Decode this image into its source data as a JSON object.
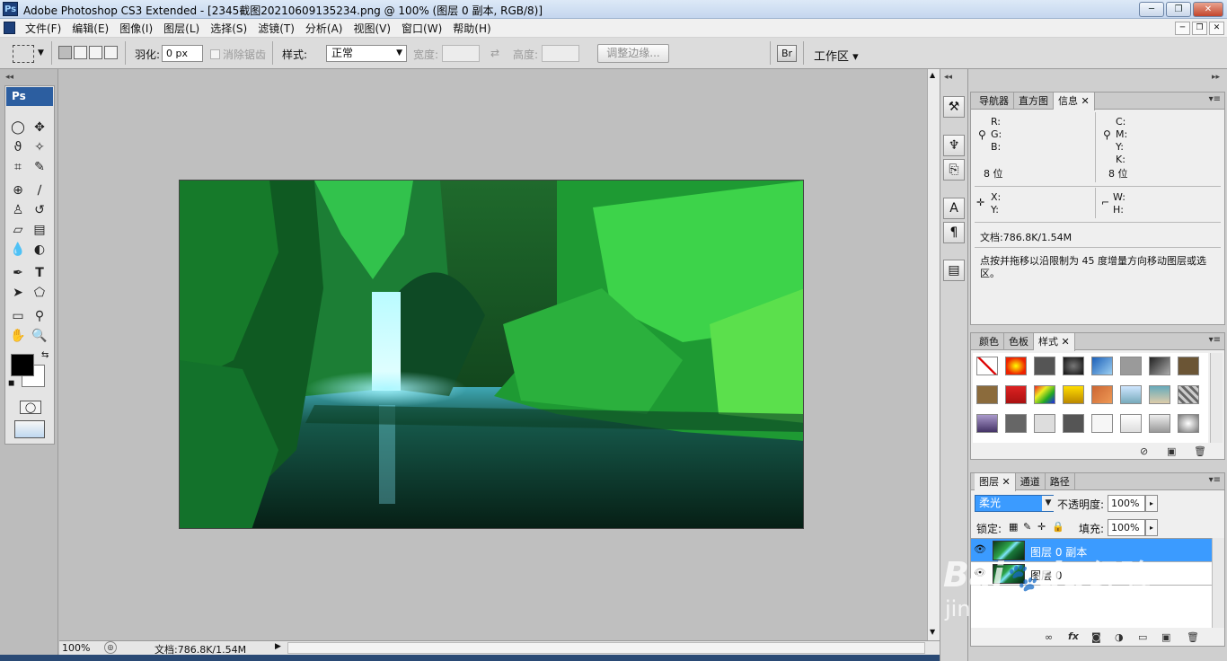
{
  "app": {
    "title": "Adobe Photoshop CS3 Extended - [2345截图20210609135234.png @ 100% (图层 0 副本, RGB/8)]",
    "icon_text": "Ps"
  },
  "window_buttons": {
    "minimize": "─",
    "maximize": "❐",
    "close": "✕"
  },
  "menus": [
    "文件(F)",
    "编辑(E)",
    "图像(I)",
    "图层(L)",
    "选择(S)",
    "滤镜(T)",
    "分析(A)",
    "视图(V)",
    "窗口(W)",
    "帮助(H)"
  ],
  "options": {
    "feather_label": "羽化:",
    "feather_value": "0 px",
    "antialias_label": "消除锯齿",
    "style_label": "样式:",
    "style_value": "正常",
    "width_label": "宽度:",
    "height_label": "高度:",
    "refine_edge_label": "调整边缘...",
    "workspace_label": "工作区 ▾"
  },
  "toolbox": {
    "header": "Ps",
    "foreground_color": "#000000",
    "background_color": "#ffffff"
  },
  "info_panel": {
    "tabs": [
      "导航器",
      "直方图",
      "信息"
    ],
    "active_tab": "信息",
    "rgb_labels": [
      "R:",
      "G:",
      "B:"
    ],
    "cmyk_labels": [
      "C:",
      "M:",
      "Y:",
      "K:"
    ],
    "bits_left": "8 位",
    "bits_right": "8 位",
    "xy_labels": [
      "X:",
      "Y:"
    ],
    "wh_labels": [
      "W:",
      "H:"
    ],
    "doc": "文档:786.8K/1.54M",
    "hint": "点按并拖移以沿限制为 45 度增量方向移动图层或选区。"
  },
  "styles_panel": {
    "tabs": [
      "颜色",
      "色板",
      "样式"
    ],
    "active_tab": "样式"
  },
  "layers_panel": {
    "tabs": [
      "图层",
      "通道",
      "路径"
    ],
    "active_tab": "图层",
    "blend_mode": "柔光",
    "opacity_label": "不透明度:",
    "opacity_value": "100%",
    "lock_label": "锁定:",
    "fill_label": "填充:",
    "fill_value": "100%",
    "layers": [
      {
        "name": "图层 0 副本",
        "selected": true
      },
      {
        "name": "图层 0",
        "selected": false
      }
    ]
  },
  "status": {
    "zoom": "100%",
    "doc": "文档:786.8K/1.54M"
  },
  "watermark": {
    "brand": "Bai",
    "brand2": "du",
    "cn": "经验",
    "url": "jingyan.baidu.com"
  },
  "colors": {
    "selection_blue": "#3b9bff",
    "ps_blue": "#2c5ea0"
  }
}
